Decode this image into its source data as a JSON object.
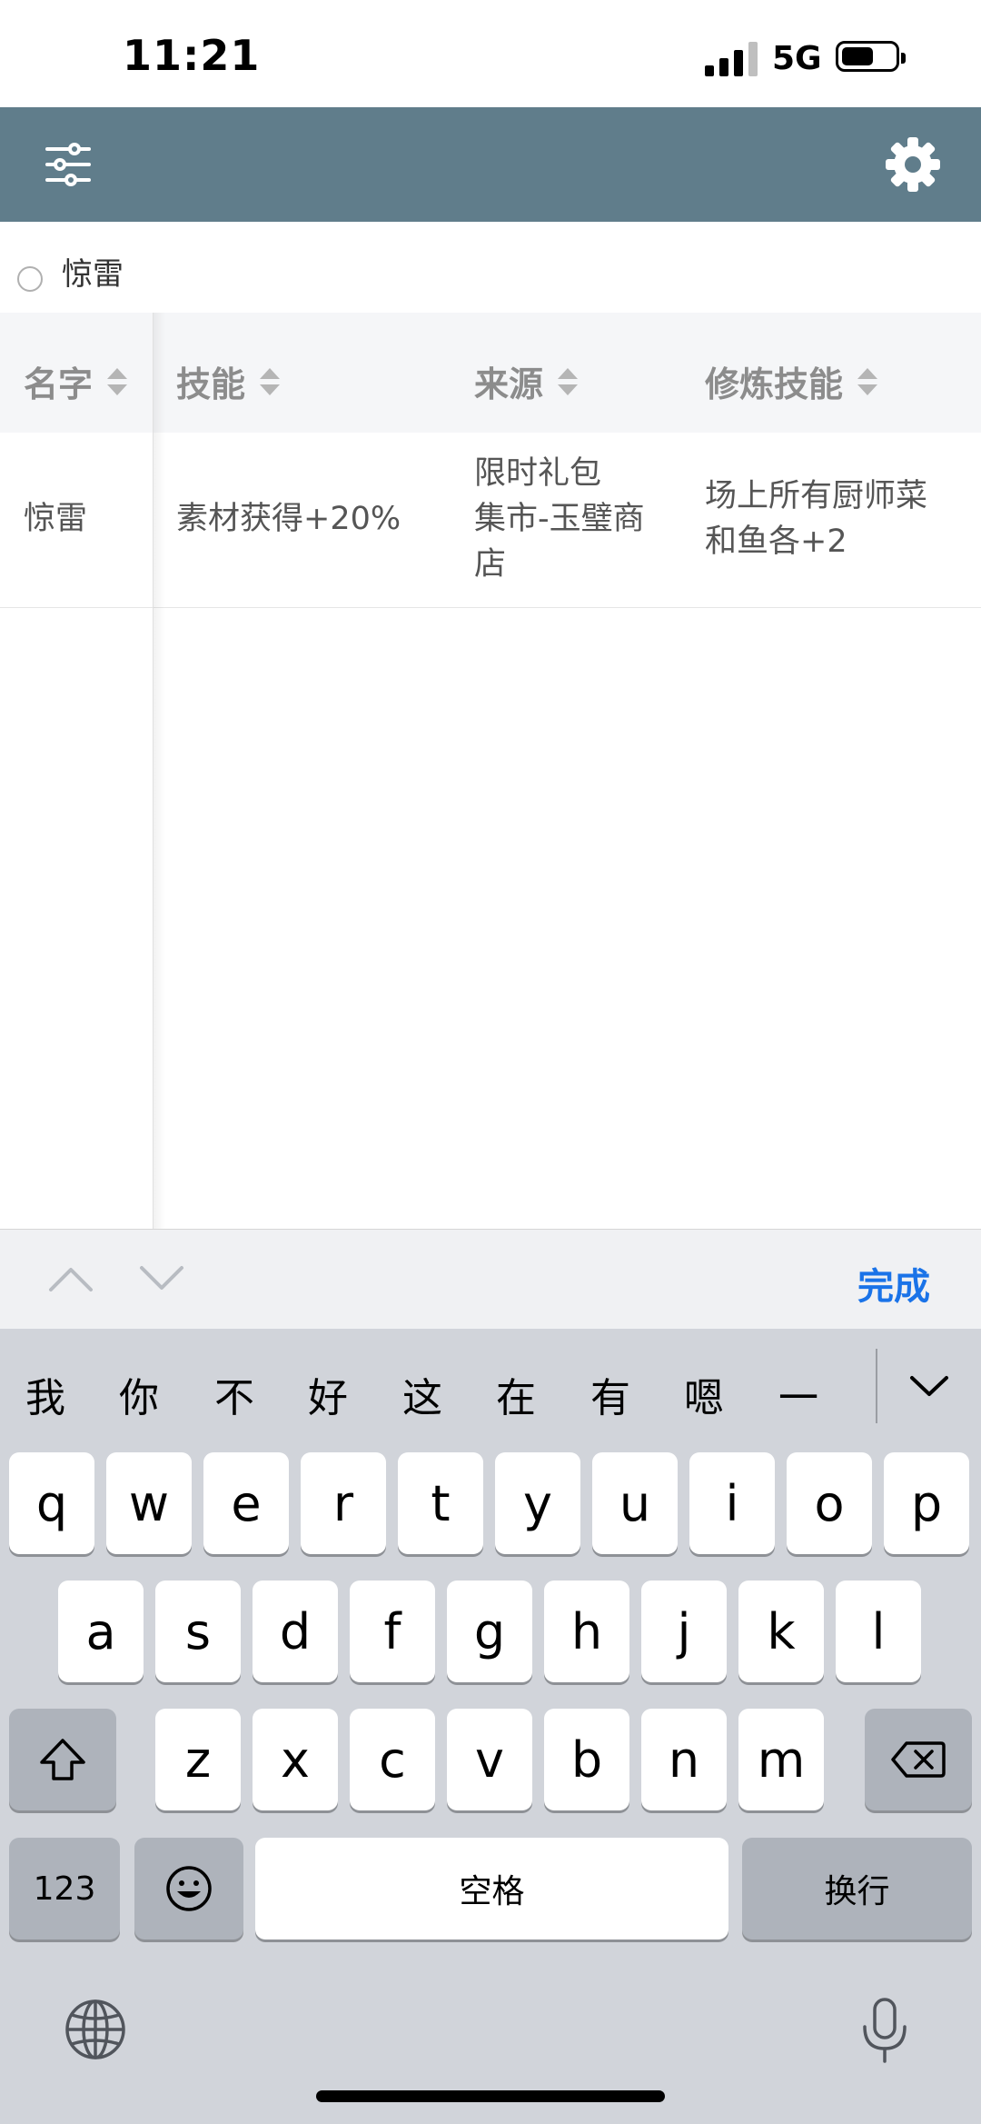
{
  "status_bar": {
    "time": "11:21",
    "network": "5G",
    "battery_level": 0.6
  },
  "header": {
    "filter_icon": "sliders-icon",
    "settings_icon": "gear-icon"
  },
  "search": {
    "value": "惊雷"
  },
  "table": {
    "columns": [
      "名字",
      "技能",
      "来源",
      "修炼技能"
    ],
    "rows": [
      {
        "name": "惊雷",
        "skill": "素材获得+20%",
        "source_lines": [
          "限时礼包",
          "集市-玉璧商",
          "店"
        ],
        "training_lines": [
          "场上所有厨师菜",
          "和鱼各+2"
        ]
      }
    ]
  },
  "accessory": {
    "done_label": "完成"
  },
  "keyboard": {
    "candidates": [
      "我",
      "你",
      "不",
      "好",
      "这",
      "在",
      "有",
      "嗯",
      "一"
    ],
    "row1": [
      "q",
      "w",
      "e",
      "r",
      "t",
      "y",
      "u",
      "i",
      "o",
      "p"
    ],
    "row2": [
      "a",
      "s",
      "d",
      "f",
      "g",
      "h",
      "j",
      "k",
      "l"
    ],
    "row3": [
      "z",
      "x",
      "c",
      "v",
      "b",
      "n",
      "m"
    ],
    "numbers_label": "123",
    "space_label": "空格",
    "return_label": "换行"
  }
}
